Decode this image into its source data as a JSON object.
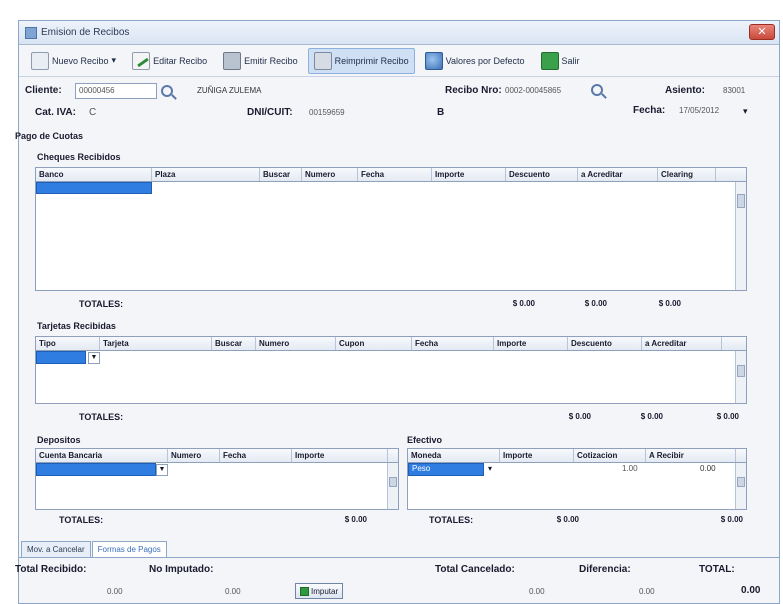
{
  "window": {
    "title": "Emision de Recibos",
    "close_glyph": "✕"
  },
  "toolbar": {
    "nuevo": "Nuevo Recibo",
    "editar": "Editar Recibo",
    "emitir": "Emitir Recibo",
    "reimprimir": "Reimprimir Recibo",
    "valores": "Valores por Defecto",
    "salir": "Salir"
  },
  "header": {
    "cliente_label": "Cliente:",
    "cliente_code": "00000456",
    "cliente_name": "ZUÑIGA ZULEMA",
    "recibo_label": "Recibo Nro:",
    "recibo_value": "0002-00045865",
    "asiento_label": "Asiento:",
    "asiento_value": "83001",
    "cat_label": "Cat. IVA:",
    "cat_value": "C",
    "dni_label": "DNI/CUIT:",
    "dni_value": "00159659",
    "letra": "B",
    "fecha_label": "Fecha:",
    "fecha_value": "17/05/2012"
  },
  "pago_title": "Pago de Cuotas",
  "cheques": {
    "title": "Cheques Recibidos",
    "columns": [
      "Banco",
      "Plaza",
      "Buscar",
      "Numero",
      "Fecha",
      "Importe",
      "Descuento",
      "a Acreditar",
      "Clearing"
    ],
    "totales_label": "TOTALES:",
    "totals": [
      "$ 0.00",
      "$ 0.00",
      "$ 0.00"
    ]
  },
  "tarjetas": {
    "title": "Tarjetas Recibidas",
    "columns": [
      "Tipo",
      "Tarjeta",
      "Buscar",
      "Numero",
      "Cupon",
      "Fecha",
      "Importe",
      "Descuento",
      "a Acreditar"
    ],
    "totales_label": "TOTALES:",
    "totals": [
      "$ 0.00",
      "$ 0.00",
      "$ 0.00"
    ]
  },
  "depositos": {
    "title": "Depositos",
    "columns": [
      "Cuenta Bancaria",
      "Numero",
      "Fecha",
      "Importe"
    ],
    "totales_label": "TOTALES:",
    "total": "$ 0.00"
  },
  "efectivo": {
    "title": "Efectivo",
    "columns": [
      "Moneda",
      "Importe",
      "Cotizacion",
      "A Recibir"
    ],
    "row": {
      "moneda": "Peso",
      "cotizacion": "1.00",
      "recibir": "0.00"
    },
    "totales_label": "TOTALES:",
    "totals": [
      "$ 0.00",
      "$ 0.00"
    ]
  },
  "tabs": [
    "Mov. a Cancelar",
    "Formas de Pagos"
  ],
  "footer": {
    "total_recibido_label": "Total Recibido:",
    "total_recibido": "0.00",
    "no_imputado_label": "No Imputado:",
    "no_imputado": "0.00",
    "imputar_btn": "Imputar",
    "total_cancelado_label": "Total Cancelado:",
    "total_cancelado": "0.00",
    "diferencia_label": "Diferencia:",
    "diferencia": "0.00",
    "total_label": "TOTAL:",
    "total": "0.00"
  },
  "colors": {
    "selection": "#2f7de1",
    "accent": "#3a6fc0"
  }
}
